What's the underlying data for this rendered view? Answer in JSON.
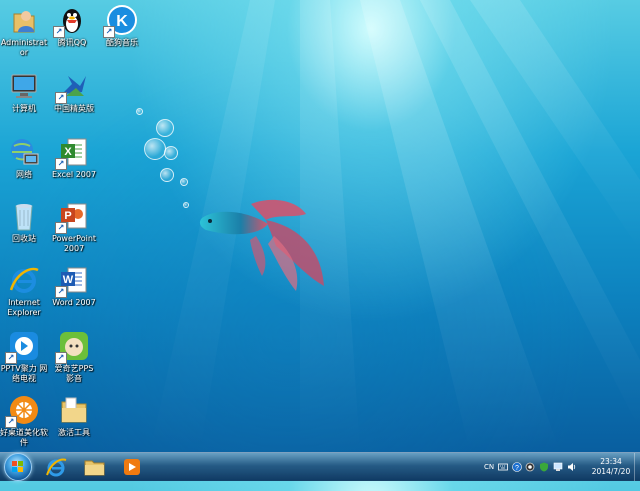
{
  "desktop": {
    "icons": [
      {
        "label": "Administrator",
        "icon": "user-folder-icon"
      },
      {
        "label": "腾讯QQ",
        "icon": "qq-penguin-icon"
      },
      {
        "label": "酷狗音乐",
        "icon": "kugou-icon"
      },
      {
        "label": "计算机",
        "icon": "computer-icon"
      },
      {
        "label": "中国精英版",
        "icon": "app-shortcut-icon"
      },
      {
        "label": "网络",
        "icon": "network-icon"
      },
      {
        "label": "Excel 2007",
        "icon": "excel-icon"
      },
      {
        "label": "回收站",
        "icon": "recycle-bin-icon"
      },
      {
        "label": "PowerPoint 2007",
        "icon": "powerpoint-icon"
      },
      {
        "label": "Internet Explorer",
        "icon": "ie-icon"
      },
      {
        "label": "Word 2007",
        "icon": "word-icon"
      },
      {
        "label": "PPTV聚力 网络电视",
        "icon": "pptv-icon"
      },
      {
        "label": "爱奇艺PPS 影音",
        "icon": "pps-icon"
      },
      {
        "label": "好桌道美化软件",
        "icon": "orange-app-icon"
      },
      {
        "label": "激活工具",
        "icon": "folder-icon"
      }
    ]
  },
  "taskbar": {
    "start": "windows-start-icon",
    "pinned": [
      "ie-icon",
      "explorer-folder-icon",
      "media-player-icon"
    ],
    "tray": {
      "language": "CN",
      "icons": [
        "keyboard-icon",
        "help-icon",
        "antivirus-icon",
        "shield-icon",
        "network-icon",
        "volume-icon"
      ]
    },
    "clock": {
      "time": "23:34",
      "date": "2014/7/20"
    }
  }
}
